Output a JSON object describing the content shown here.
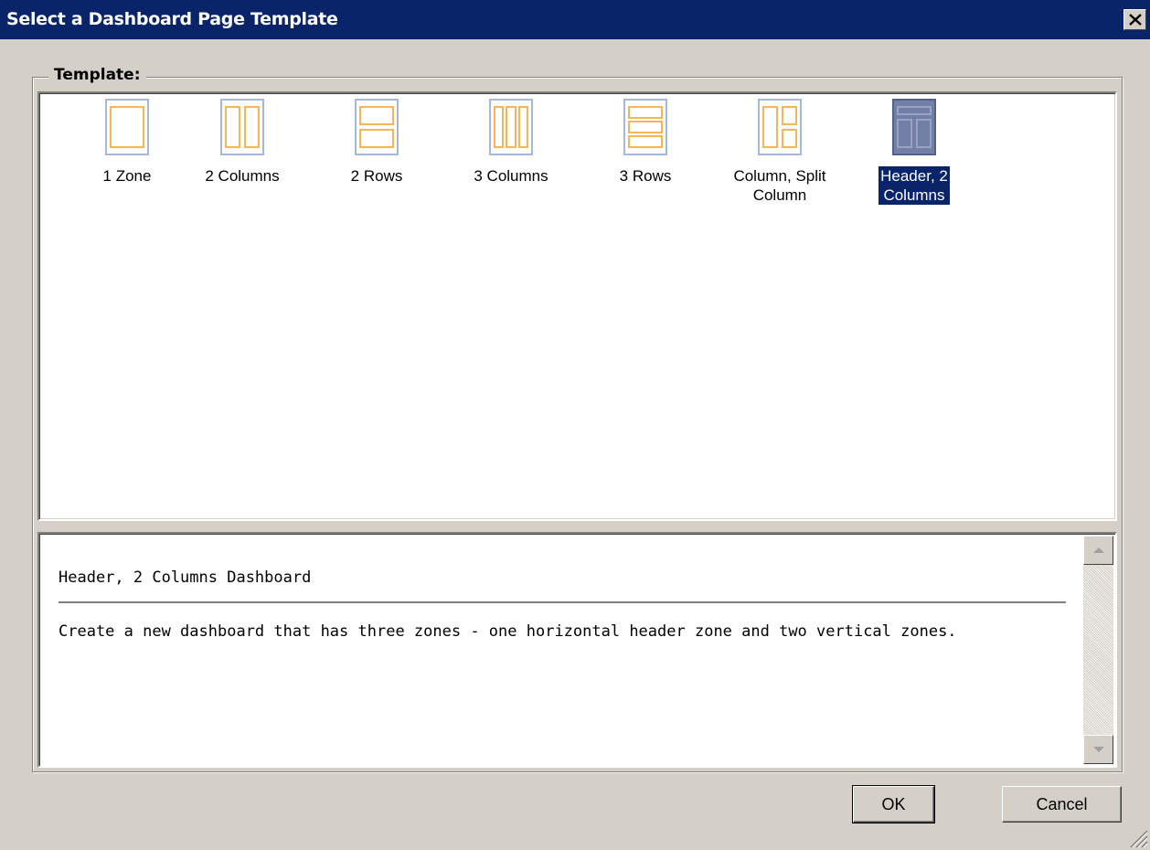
{
  "dialog": {
    "title": "Select a Dashboard Page Template",
    "close_symbol": "×",
    "group_label": "Template:"
  },
  "templates": [
    {
      "label": "1 Zone",
      "icon": "one-zone-layout-icon",
      "selected": false
    },
    {
      "label": "2 Columns",
      "icon": "two-columns-layout-icon",
      "selected": false
    },
    {
      "label": "2 Rows",
      "icon": "two-rows-layout-icon",
      "selected": false
    },
    {
      "label": "3 Columns",
      "icon": "three-columns-layout-icon",
      "selected": false
    },
    {
      "label": "3 Rows",
      "icon": "three-rows-layout-icon",
      "selected": false
    },
    {
      "label_line1": "Column, Split",
      "label_line2": "Column",
      "icon": "column-split-column-layout-icon",
      "selected": false
    },
    {
      "label_line1": "Header, 2",
      "label_line2": "Columns",
      "icon": "header-two-columns-layout-icon",
      "selected": true
    }
  ],
  "description": {
    "title": "Header, 2 Columns Dashboard",
    "body": "Create a new dashboard that has three zones - one horizontal header zone and two vertical zones."
  },
  "buttons": {
    "ok": "OK",
    "cancel": "Cancel"
  },
  "colors": {
    "titlebar": "#0a246a",
    "zone_outline": "#f5b65a",
    "selection": "#0a246a",
    "face": "#d4d0c8"
  }
}
